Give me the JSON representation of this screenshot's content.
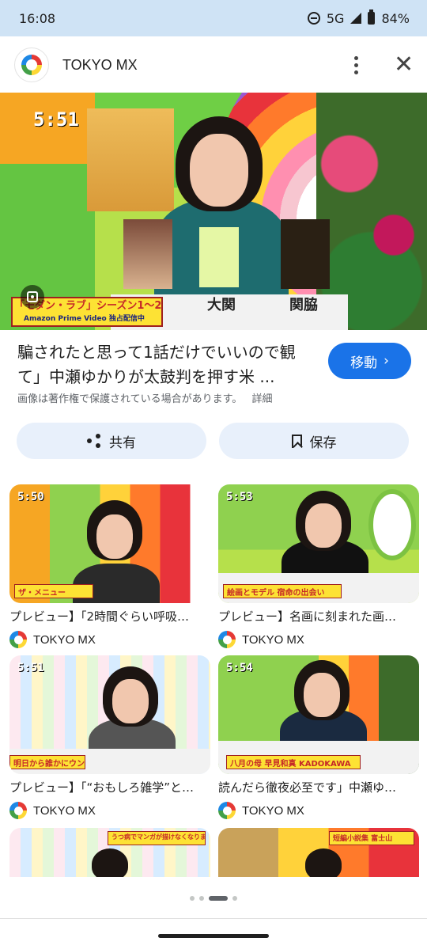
{
  "status_bar": {
    "time": "16:08",
    "network": "5G",
    "battery": "84%"
  },
  "header": {
    "title": "TOKYO MX"
  },
  "hero": {
    "timestamp": "5:51",
    "caption_top": "「モダン・ラブ」シーズン1～2",
    "caption_bottom": "Amazon Prime Video 独占配信中",
    "desk_labels": [
      "大関",
      "関脇"
    ]
  },
  "result": {
    "title": "騙されたと思って1話だけでいいので観て」中瀬ゆかりが太鼓判を押す米 ...",
    "visit_label": "移動",
    "copyright_notice": "画像は著作権で保護されている場合があります。",
    "details_label": "詳細"
  },
  "actions": {
    "share_label": "共有",
    "save_label": "保存"
  },
  "related": [
    {
      "title": "プレビュー】「2時間ぐらい呼吸…",
      "source": "TOKYO MX",
      "timestamp": "5:50",
      "caption": "ザ・メニュー"
    },
    {
      "title": "プレビュー】名画に刻まれた画…",
      "source": "TOKYO MX",
      "timestamp": "5:53",
      "caption": "絵画とモデル 宿命の出会い"
    },
    {
      "title": "プレビュー】「“おもしろ雑学”と…",
      "source": "TOKYO MX",
      "timestamp": "5:51",
      "caption": "明日から誰かにウンチク"
    },
    {
      "title": "読んだら徹夜必至です」中瀬ゆ…",
      "source": "TOKYO MX",
      "timestamp": "5:54",
      "caption": "八月の母 早見和真 KADOKAWA"
    },
    {
      "title": "",
      "source": "",
      "timestamp": "",
      "caption": "うつ病でマンガが描けなくなりました"
    },
    {
      "title": "",
      "source": "",
      "timestamp": "",
      "caption": "短編小説集 富士山"
    }
  ],
  "colors": {
    "accent": "#1a73e8",
    "status_bar": "#cfe3f5",
    "chip_bg": "#e8f0fb"
  }
}
